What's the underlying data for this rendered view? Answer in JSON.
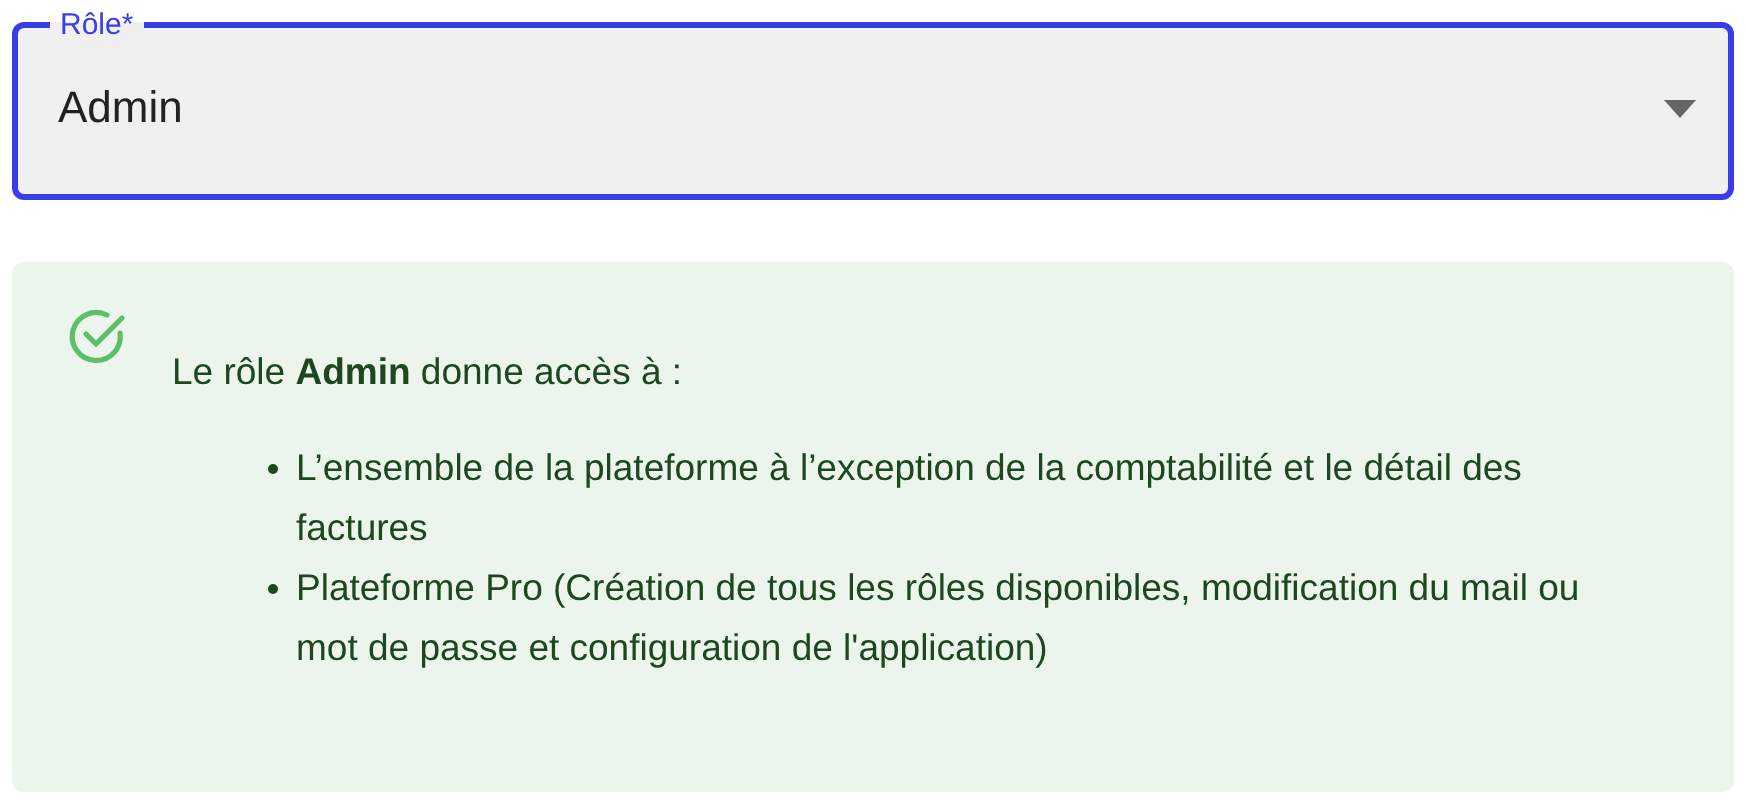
{
  "role_select": {
    "label": "Rôle*",
    "value": "Admin",
    "focused": true
  },
  "info": {
    "intro": "Le rôle **Admin** donne accès à :",
    "items": [
      "L’ensemble de la plateforme à l’exception de la comptabilité et le détail des factures",
      "Plateforme Pro (Création de tous les rôles disponibles, modification du mail ou mot de passe et configuration de l'application)"
    ]
  }
}
